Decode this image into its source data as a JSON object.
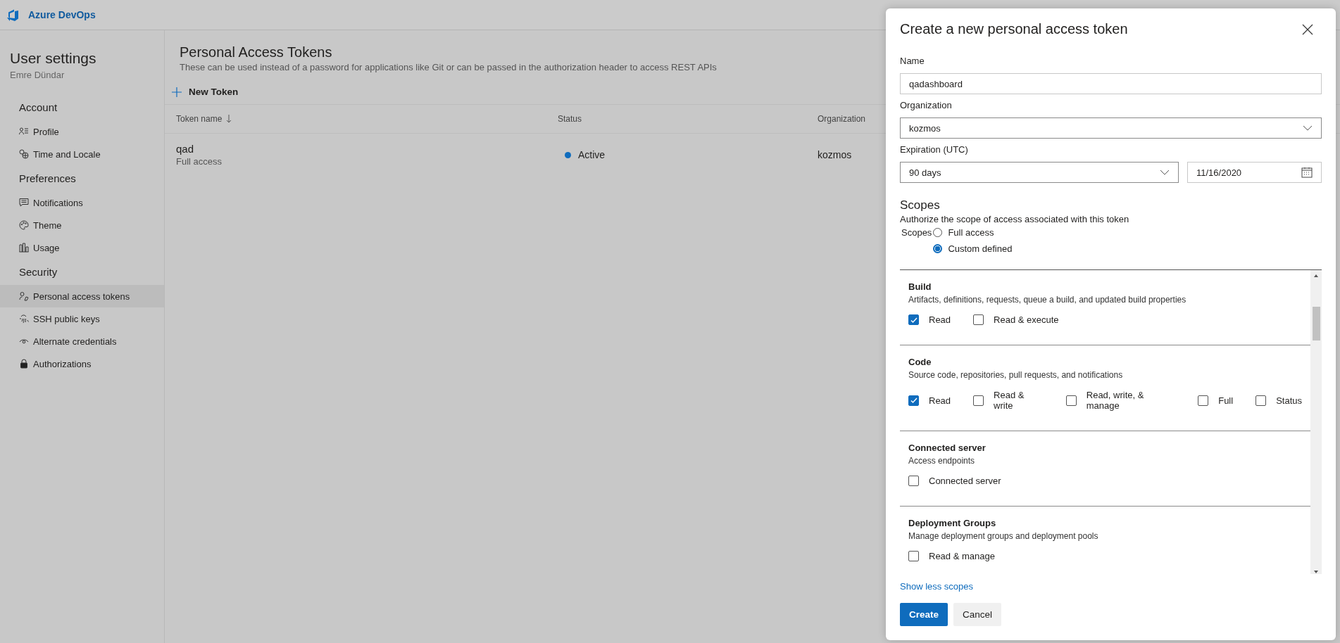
{
  "app": {
    "name": "Azure DevOps"
  },
  "sidebar": {
    "title": "User settings",
    "user": "Emre Dündar",
    "sections": [
      {
        "heading": "Account",
        "items": [
          {
            "label": "Profile",
            "selected": false
          },
          {
            "label": "Time and Locale",
            "selected": false
          }
        ]
      },
      {
        "heading": "Preferences",
        "items": [
          {
            "label": "Notifications",
            "selected": false
          },
          {
            "label": "Theme",
            "selected": false
          },
          {
            "label": "Usage",
            "selected": false
          }
        ]
      },
      {
        "heading": "Security",
        "items": [
          {
            "label": "Personal access tokens",
            "selected": true
          },
          {
            "label": "SSH public keys",
            "selected": false
          },
          {
            "label": "Alternate credentials",
            "selected": false
          },
          {
            "label": "Authorizations",
            "selected": false
          }
        ]
      }
    ]
  },
  "main": {
    "title": "Personal Access Tokens",
    "description": "These can be used instead of a password for applications like Git or can be passed in the authorization header to access REST APIs",
    "new_token": "New Token",
    "columns": [
      {
        "label": "Token name",
        "sorted": true
      },
      {
        "label": "Status",
        "sorted": false
      },
      {
        "label": "Organization",
        "sorted": false
      }
    ],
    "rows": [
      {
        "name": "qad",
        "scope": "Full access",
        "status": "Active",
        "organization": "kozmos"
      }
    ]
  },
  "dialog": {
    "title": "Create a new personal access token",
    "name": {
      "label": "Name",
      "value": "qadashboard"
    },
    "organization": {
      "label": "Organization",
      "value": "kozmos"
    },
    "expiration": {
      "label": "Expiration (UTC)",
      "value": "90 days",
      "date": "11/16/2020"
    },
    "scopes": {
      "heading": "Scopes",
      "description": "Authorize the scope of access associated with this token",
      "group_label": "Scopes",
      "options": [
        {
          "label": "Full access",
          "selected": false
        },
        {
          "label": "Custom defined",
          "selected": true
        }
      ]
    },
    "scope_groups": [
      {
        "title": "Build",
        "description": "Artifacts, definitions, requests, queue a build, and updated build properties",
        "permissions": [
          {
            "label": "Read",
            "checked": true
          },
          {
            "label": "Read & execute",
            "checked": false
          }
        ]
      },
      {
        "title": "Code",
        "description": "Source code, repositories, pull requests, and notifications",
        "permissions": [
          {
            "label": "Read",
            "checked": true
          },
          {
            "label": "Read & write",
            "checked": false
          },
          {
            "label": "Read, write, & manage",
            "checked": false
          },
          {
            "label": "Full",
            "checked": false
          },
          {
            "label": "Status",
            "checked": false
          }
        ]
      },
      {
        "title": "Connected server",
        "description": "Access endpoints",
        "permissions": [
          {
            "label": "Connected server",
            "checked": false
          }
        ]
      },
      {
        "title": "Deployment Groups",
        "description": "Manage deployment groups and deployment pools",
        "permissions": [
          {
            "label": "Read & manage",
            "checked": false
          }
        ]
      }
    ],
    "show_less": "Show less scopes",
    "buttons": [
      {
        "label": "Create",
        "kind": "primary"
      },
      {
        "label": "Cancel",
        "kind": "default"
      }
    ]
  }
}
